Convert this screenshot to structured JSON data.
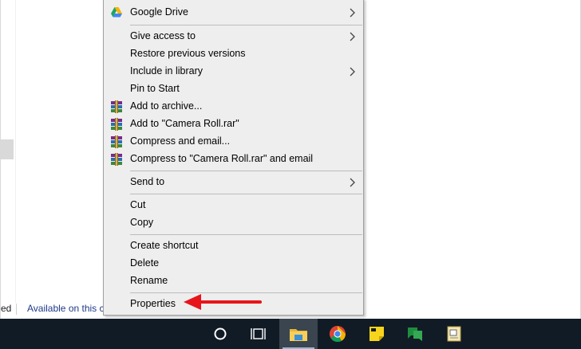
{
  "explorer": {
    "status_left": "ed",
    "status_available": "Available on this c"
  },
  "menu": {
    "items": [
      {
        "label": "Google Drive",
        "icon": "google-drive-icon",
        "submenu": true
      },
      {
        "label": "Give access to",
        "submenu": true
      },
      {
        "label": "Restore previous versions"
      },
      {
        "label": "Include in library",
        "submenu": true
      },
      {
        "label": "Pin to Start"
      },
      {
        "label": "Add to archive...",
        "icon": "winrar-icon"
      },
      {
        "label": "Add to \"Camera Roll.rar\"",
        "icon": "winrar-icon"
      },
      {
        "label": "Compress and email...",
        "icon": "winrar-icon"
      },
      {
        "label": "Compress to \"Camera Roll.rar\" and email",
        "icon": "winrar-icon"
      },
      {
        "label": "Send to",
        "submenu": true
      },
      {
        "label": "Cut"
      },
      {
        "label": "Copy"
      },
      {
        "label": "Create shortcut"
      },
      {
        "label": "Delete"
      },
      {
        "label": "Rename"
      },
      {
        "label": "Properties"
      }
    ]
  },
  "taskbar": {
    "buttons": [
      "cortana-icon",
      "task-view-icon",
      "file-explorer-icon",
      "chrome-icon",
      "sticky-notes-icon",
      "google-chat-icon",
      "notepad-icon"
    ],
    "active": "file-explorer-icon"
  },
  "colors": {
    "annotation_arrow": "#e8141c",
    "taskbar": "#111b26",
    "menu_bg": "#eeeeee"
  }
}
